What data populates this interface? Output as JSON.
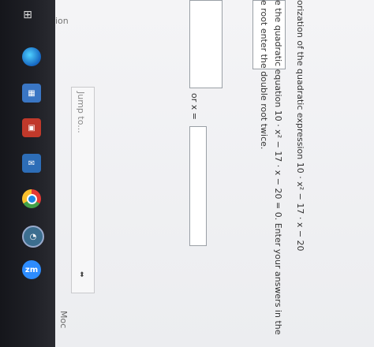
{
  "taskbar": {
    "icons": [
      "grid-icon",
      "edge-icon",
      "store-icon",
      "office-icon",
      "mail-icon",
      "chrome-icon",
      "circle-icon",
      "zoom-icon"
    ],
    "zoom_label": "zm"
  },
  "question1": {
    "text": "orization of the quadratic expression 10 · x² − 17 · x − 20"
  },
  "question2": {
    "line1": "e the quadratic equation 10 · x² − 17 · x − 20 = 0. Enter your answers in the",
    "line2": "e root enter the double root twice.",
    "or_label": "or x ="
  },
  "nav": {
    "section_label": "ion",
    "jump_to": "Jump to...",
    "bottom_label": "Moc"
  }
}
